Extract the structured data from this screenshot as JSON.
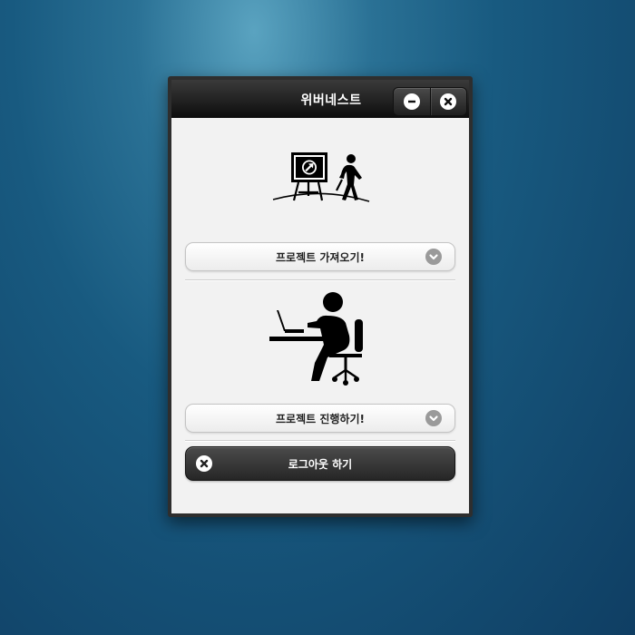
{
  "window": {
    "title": "위버네스트"
  },
  "menu": {
    "import_label": "프로젝트 가져오기!",
    "progress_label": "프로젝트 진행하기!",
    "logout_label": "로그아웃 하기"
  },
  "icons": {
    "import": "presentation-walker-icon",
    "progress": "person-at-computer-icon",
    "minimize": "minus-icon",
    "close": "close-icon",
    "dropdown": "chevron-down-icon",
    "logout": "close-icon"
  },
  "colors": {
    "titlebar": "#1a1a1a",
    "content_bg": "#f2f2f2",
    "logout_button": "#333333"
  }
}
